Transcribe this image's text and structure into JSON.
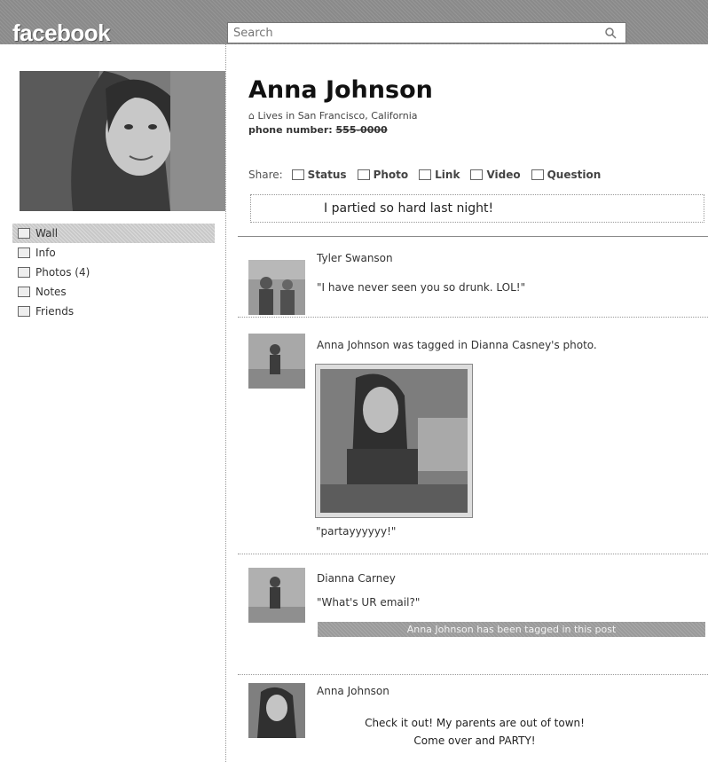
{
  "topbar": {
    "logo": "facebook",
    "search": {
      "placeholder": "Search"
    }
  },
  "left_nav": [
    {
      "label": "Wall",
      "icon": "wall-icon"
    },
    {
      "label": "Info",
      "icon": "info-icon"
    },
    {
      "label": "Photos (4)",
      "icon": "photos-icon"
    },
    {
      "label": "Notes",
      "icon": "notes-icon"
    },
    {
      "label": "Friends",
      "icon": "friends-icon"
    }
  ],
  "profile": {
    "name": "Anna Johnson",
    "lives": "Lives in San Francisco, California",
    "phone_label": "phone number:",
    "phone_value": "555-0000"
  },
  "share": {
    "label": "Share:",
    "options": [
      "Status",
      "Photo",
      "Link",
      "Video",
      "Question"
    ],
    "status_text": "I partied so hard last night!"
  },
  "feed": [
    {
      "author": "Tyler Swanson",
      "text": "\"I have never seen you so drunk. LOL!\""
    },
    {
      "headline": "Anna Johnson was tagged in Dianna Casney's photo.",
      "caption": "\"partayyyyyy!\""
    },
    {
      "author": "Dianna Carney",
      "text": "\"What's UR email?\"",
      "banner": "Anna Johnson has been tagged in this post"
    },
    {
      "author": "Anna Johnson",
      "line1": "Check it out! My parents are out of town!",
      "line2": "Come over and PARTY!"
    }
  ]
}
